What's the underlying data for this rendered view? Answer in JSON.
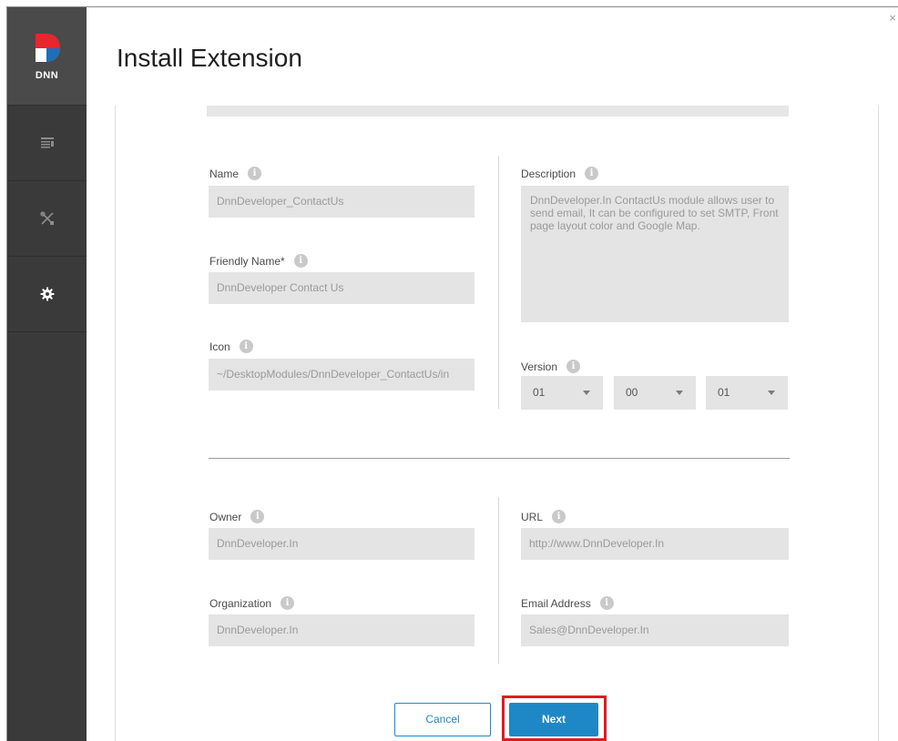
{
  "app": {
    "logo_text": "DNN",
    "close_glyph": "×"
  },
  "sidebar": {
    "items": [
      {
        "icon": "content-list-icon",
        "active": false
      },
      {
        "icon": "tools-icon",
        "active": false
      },
      {
        "icon": "gear-icon",
        "active": true
      }
    ]
  },
  "header": {
    "title": "Install Extension"
  },
  "form": {
    "name": {
      "label": "Name",
      "value": "DnnDeveloper_ContactUs"
    },
    "friendly_name": {
      "label": "Friendly Name*",
      "value": "DnnDeveloper Contact Us"
    },
    "icon": {
      "label": "Icon",
      "value": "~/DesktopModules/DnnDeveloper_ContactUs/in"
    },
    "description": {
      "label": "Description",
      "value": "DnnDeveloper.In ContactUs module allows user to send email, It can be configured to set SMTP, Front page layout color and Google Map."
    },
    "version": {
      "label": "Version",
      "major": "01",
      "minor": "00",
      "patch": "01"
    },
    "owner": {
      "label": "Owner",
      "value": "DnnDeveloper.In"
    },
    "organization": {
      "label": "Organization",
      "value": "DnnDeveloper.In"
    },
    "url": {
      "label": "URL",
      "value": "http://www.DnnDeveloper.In"
    },
    "email": {
      "label": "Email Address",
      "value": "Sales@DnnDeveloper.In"
    }
  },
  "actions": {
    "cancel_label": "Cancel",
    "next_label": "Next"
  },
  "colors": {
    "accent": "#1e88c7",
    "highlight": "#e01b22",
    "sidebar": "#3a3a3a"
  }
}
